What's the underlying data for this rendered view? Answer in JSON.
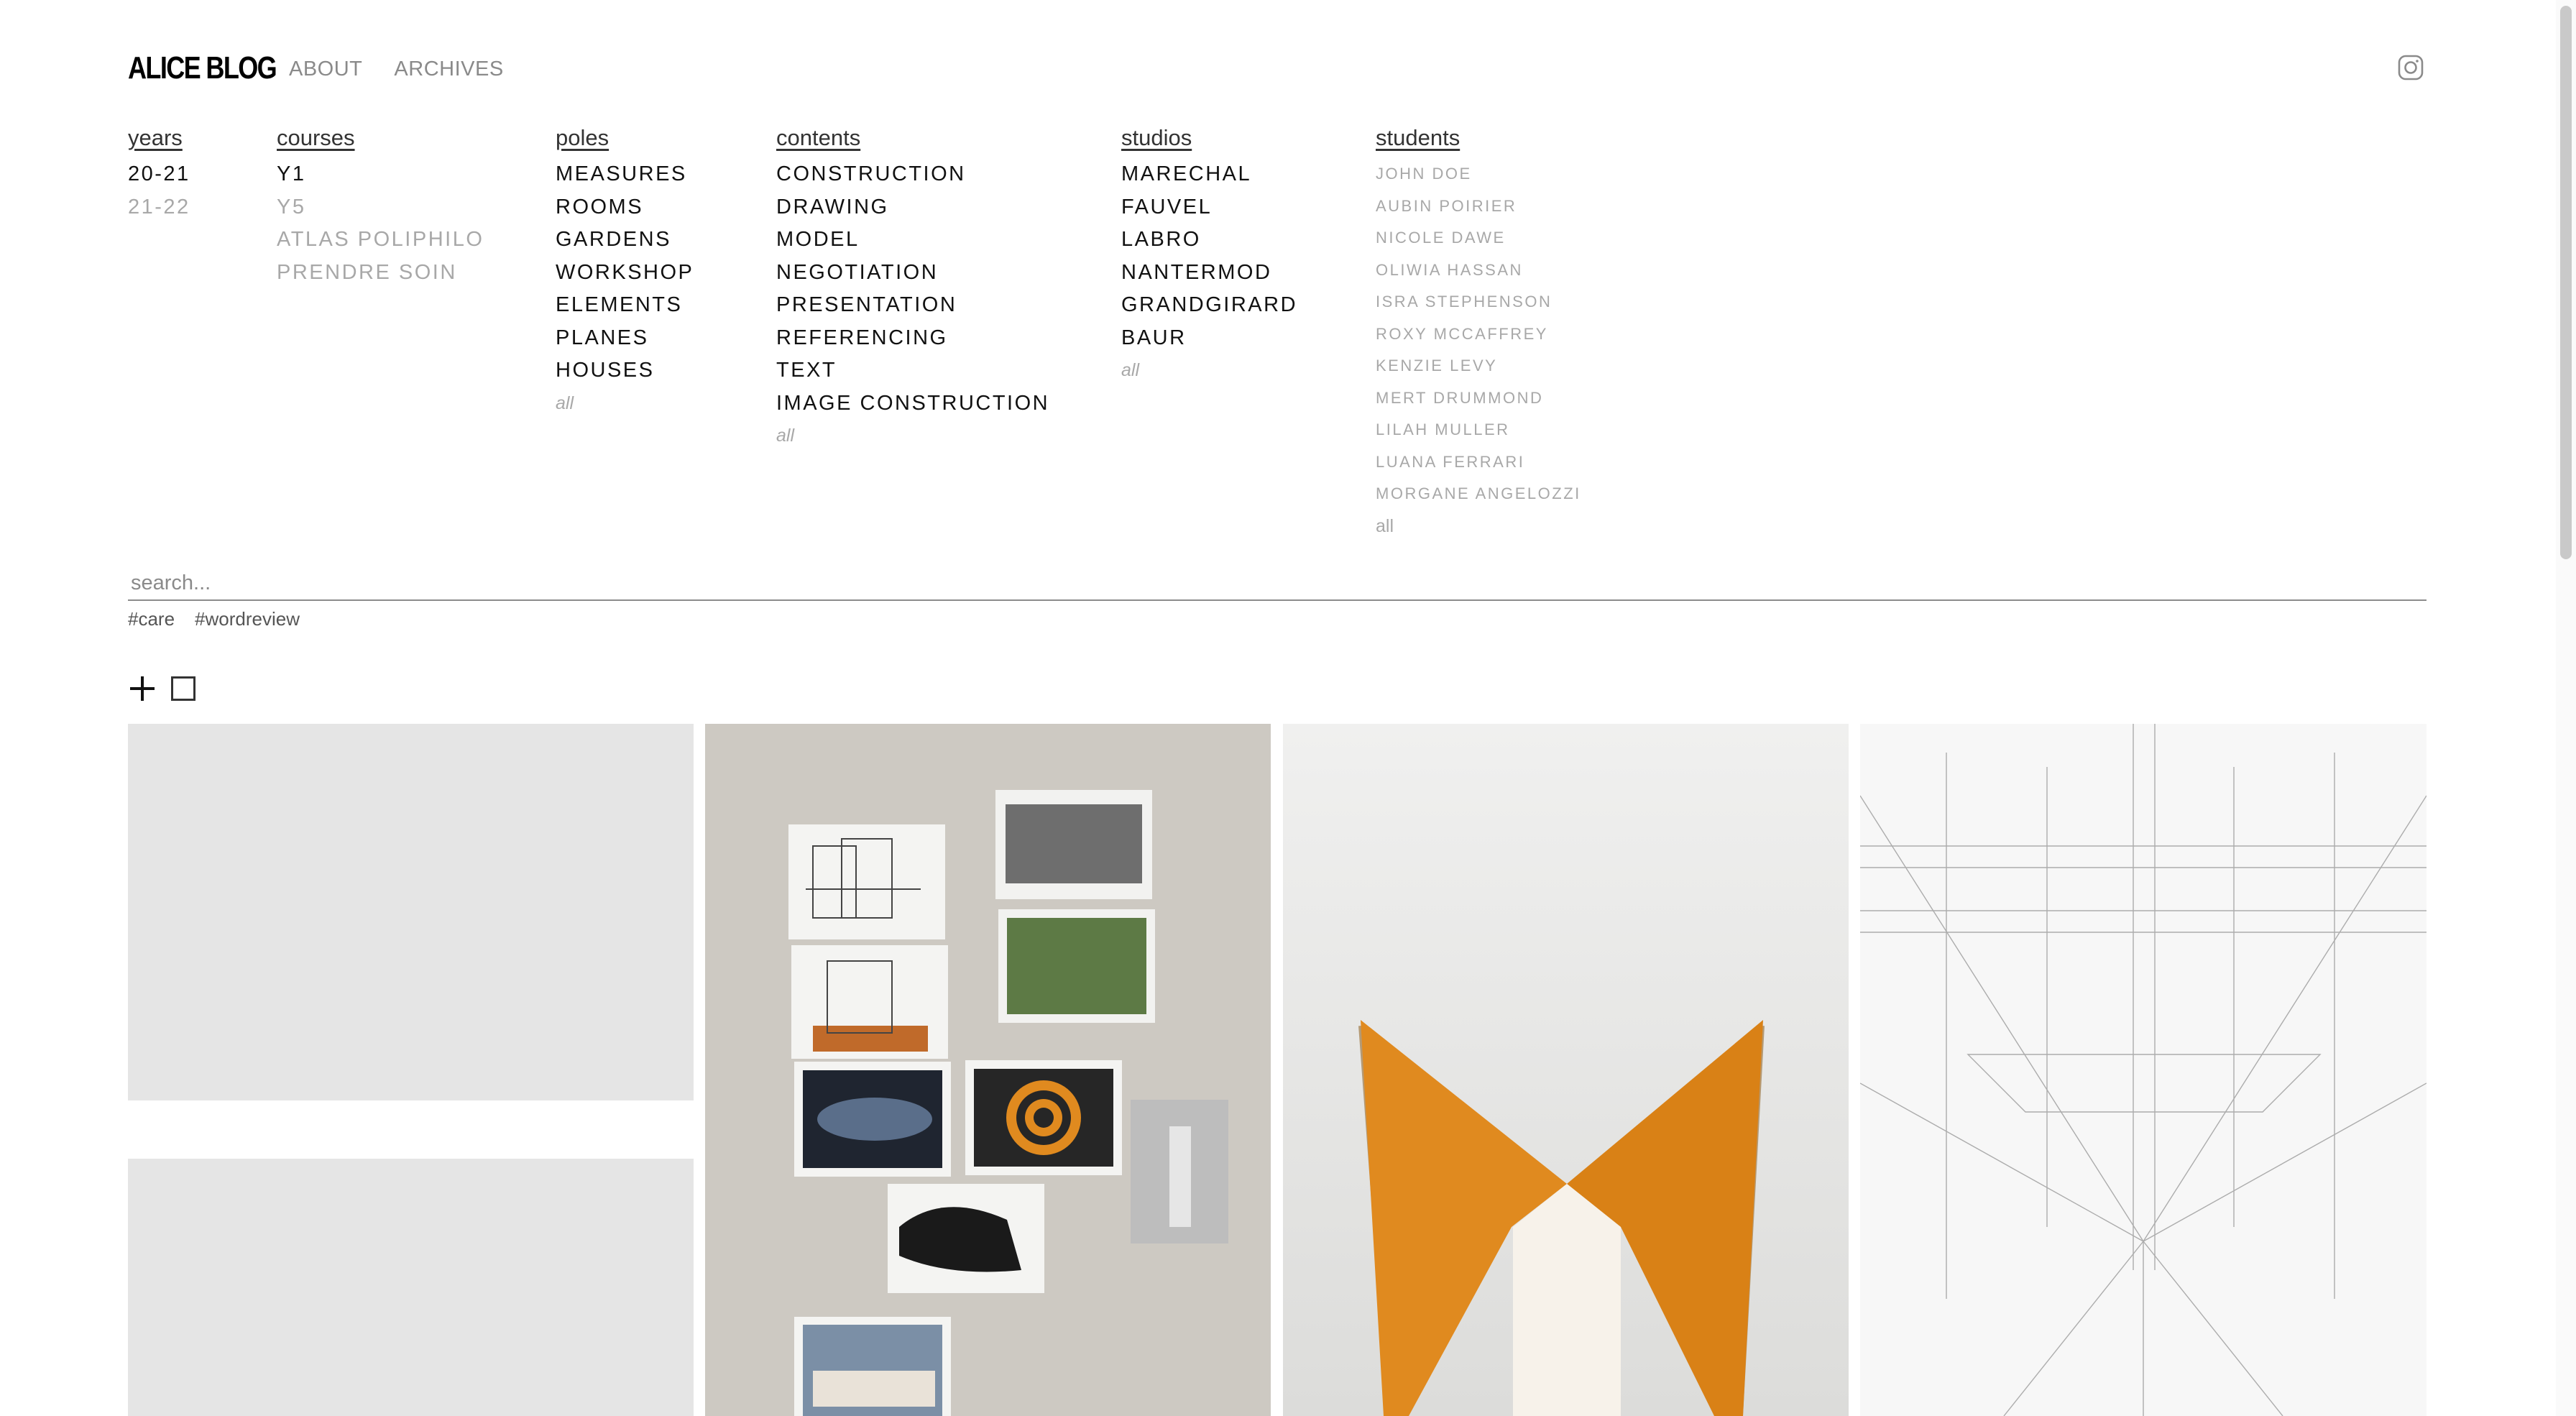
{
  "header": {
    "logo": "ALICE BLOG",
    "nav": [
      "ABOUT",
      "ARCHIVES"
    ],
    "social_icon": "instagram-icon"
  },
  "filters": {
    "years": {
      "label": "years",
      "items": [
        {
          "label": "20-21",
          "active": true
        },
        {
          "label": "21-22",
          "active": false
        }
      ]
    },
    "courses": {
      "label": "courses",
      "items": [
        {
          "label": "Y1",
          "active": true
        },
        {
          "label": "Y5",
          "active": false
        },
        {
          "label": "ATLAS POLIPHILO",
          "active": false
        },
        {
          "label": "PRENDRE SOIN",
          "active": false
        }
      ]
    },
    "poles": {
      "label": "poles",
      "items": [
        "MEASURES",
        "ROOMS",
        "GARDENS",
        "WORKSHOP",
        "ELEMENTS",
        "PLANES",
        "HOUSES"
      ],
      "all": "all"
    },
    "contents": {
      "label": "contents",
      "items": [
        "CONSTRUCTION",
        "DRAWING",
        "MODEL",
        "NEGOTIATION",
        "PRESENTATION",
        "REFERENCING",
        "TEXT",
        "IMAGE CONSTRUCTION"
      ],
      "all": "all"
    },
    "studios": {
      "label": "studios",
      "items": [
        "MARECHAL",
        "FAUVEL",
        "LABRO",
        "NANTERMOD",
        "GRANDGIRARD",
        "BAUR"
      ],
      "all": "all"
    },
    "students": {
      "label": "students",
      "items": [
        "JOHN DOE",
        "AUBIN POIRIER",
        "NICOLE DAWE",
        "OLIWIA HASSAN",
        "ISRA STEPHENSON",
        "ROXY MCCAFFREY",
        "KENZIE LEVY",
        "MERT DRUMMOND",
        "LILAH MULLER",
        "LUANA FERRARI",
        "MORGANE ANGELOZZI"
      ],
      "all": "all"
    }
  },
  "search": {
    "placeholder": "search..."
  },
  "tags": [
    "#care",
    "#wordreview"
  ],
  "view_icons": [
    "plus-icon",
    "square-icon"
  ],
  "colors": {
    "accent_orange": "#e08a1f",
    "placeholder_gray": "#e5e5e5",
    "dim_text": "#a8a8a8"
  }
}
